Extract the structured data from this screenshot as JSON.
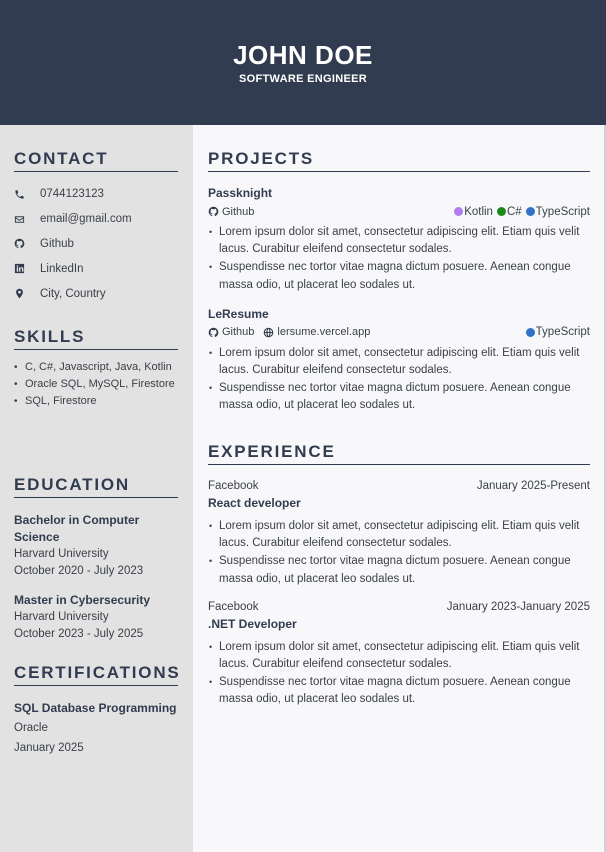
{
  "header": {
    "name": "JOHN DOE",
    "title": "SOFTWARE ENGINEER"
  },
  "contact": {
    "title": "CONTACT",
    "items": [
      {
        "icon": "phone-icon",
        "text": "0744123123"
      },
      {
        "icon": "envelope-icon",
        "text": "email@gmail.com"
      },
      {
        "icon": "github-icon",
        "text": "Github"
      },
      {
        "icon": "linkedin-icon",
        "text": "LinkedIn"
      },
      {
        "icon": "location-pin-icon",
        "text": "City, Country"
      }
    ]
  },
  "skills": {
    "title": "SKILLS",
    "items": [
      "C, C#, Javascript, Java, Kotlin",
      "Oracle SQL, MySQL, Firestore",
      "SQL, Firestore"
    ]
  },
  "education": {
    "title": "EDUCATION",
    "items": [
      {
        "degree": "Bachelor in Computer Science",
        "school": "Harvard University",
        "dates": "October 2020 - July 2023"
      },
      {
        "degree": "Master in Cybersecurity",
        "school": "Harvard University",
        "dates": "October 2023 - July 2025"
      }
    ]
  },
  "certifications": {
    "title": "CERTIFICATIONS",
    "items": [
      {
        "name": "SQL Database Programming",
        "issuer": "Oracle",
        "date": "January 2025"
      }
    ]
  },
  "projects": {
    "title": "PROJECTS",
    "items": [
      {
        "name": "Passknight",
        "links": [
          {
            "icon": "github-icon",
            "text": "Github"
          }
        ],
        "tags": [
          {
            "label": "Kotlin",
            "color": "#b07cf0"
          },
          {
            "label": "C#",
            "color": "#1a8a1a"
          },
          {
            "label": "TypeScript",
            "color": "#3172c6"
          }
        ],
        "bullets": [
          "Lorem ipsum dolor sit amet, consectetur adipiscing elit. Etiam quis velit lacus. Curabitur eleifend consectetur sodales.",
          "Suspendisse nec tortor vitae magna dictum posuere. Aenean congue massa odio, ut placerat leo sodales ut."
        ]
      },
      {
        "name": "LeResume",
        "links": [
          {
            "icon": "github-icon",
            "text": "Github"
          },
          {
            "icon": "globe-icon",
            "text": "lersume.vercel.app"
          }
        ],
        "tags": [
          {
            "label": "TypeScript",
            "color": "#3172c6"
          }
        ],
        "bullets": [
          "Lorem ipsum dolor sit amet, consectetur adipiscing elit. Etiam quis velit lacus. Curabitur eleifend consectetur sodales.",
          "Suspendisse nec tortor vitae magna dictum posuere. Aenean congue massa odio, ut placerat leo sodales ut."
        ]
      }
    ]
  },
  "experience": {
    "title": "EXPERIENCE",
    "items": [
      {
        "company": "Facebook",
        "dates": "January 2025-Present",
        "role": "React developer",
        "bullets": [
          "Lorem ipsum dolor sit amet, consectetur adipiscing elit. Etiam quis velit lacus. Curabitur eleifend consectetur sodales.",
          "Suspendisse nec tortor vitae magna dictum posuere. Aenean congue massa odio, ut placerat leo sodales ut."
        ]
      },
      {
        "company": "Facebook",
        "dates": "January 2023-January 2025",
        "role": ".NET Developer",
        "bullets": [
          "Lorem ipsum dolor sit amet, consectetur adipiscing elit. Etiam quis velit lacus. Curabitur eleifend consectetur sodales.",
          "Suspendisse nec tortor vitae magna dictum posuere. Aenean congue massa odio, ut placerat leo sodales ut."
        ]
      }
    ]
  }
}
